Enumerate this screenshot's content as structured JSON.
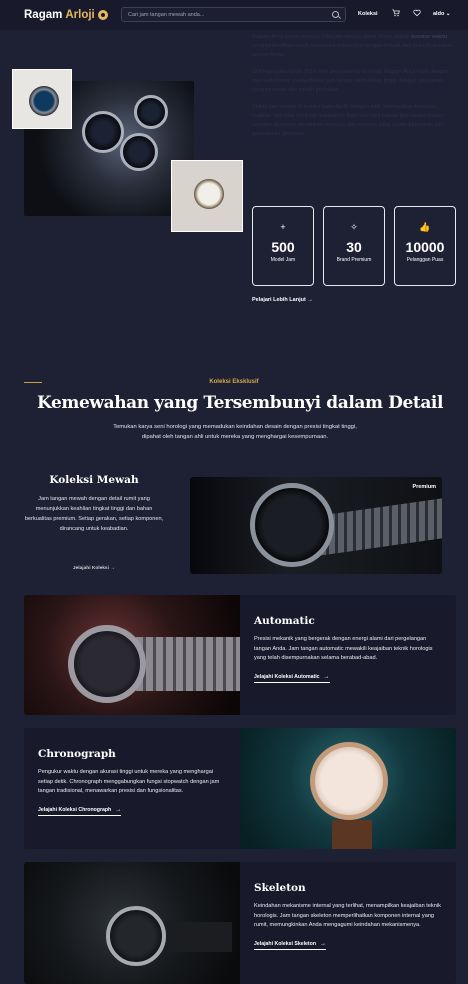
{
  "header": {
    "brand_main": "Ragam",
    "brand_accent": "Arloji",
    "search_placeholder": "Cari jam tangan mewah anda...",
    "nav_koleksi": "Koleksi",
    "user_name": "aldo",
    "cart_icon": "cart-icon",
    "heart_icon": "heart-icon"
  },
  "about": {
    "p1_a": "Ragam Arloji bukan sekadar toko jam tangan biasa. Kami adalah",
    "p1_b": "kurator waktu",
    "p1_c": "yang berdedikasi untuk membawa koleksi jam tangan terbaik dari seluruh dunia ke tangan Anda.",
    "p2": "Didirikan pada tahun 2010 oleh para pecinta horologi, Ragam Arloji telah dengan misi sederhana: menyediakan jam tangan berkualitas tinggi dengan pelayanan yang personal dan penuh perhatian.",
    "p3": "Setiap jam tangan di koleksi kami dipilih dengan teliti, memastikan keaslian, kualitas, dan nilai yang tak tertandingi. Kami percaya bahwa jam tangan bukan sekadar aksesoris melainkan investasi dan warisan yang dapat diturunkan dari generasi ke generasi.",
    "learn_more": "Pelajari Lebih Lanjut",
    "stats": [
      {
        "icon": "plus-icon",
        "glyph": "+",
        "value": "500",
        "label": "Model Jam"
      },
      {
        "icon": "sparkle-icon",
        "glyph": "✧",
        "value": "30",
        "label": "Brand Premium"
      },
      {
        "icon": "thumbs-up-icon",
        "glyph": "👍",
        "value": "10000",
        "label": "Pelanggan Puas"
      }
    ]
  },
  "exclusive": {
    "tag": "Koleksi Eksklusif",
    "title": "Kemewahan yang Tersembunyi dalam Detail",
    "desc": "Temukan karya seni horologi yang memadukan keindahan desain dengan presisi tingkat tinggi, dipahat oleh tangan ahli untuk mereka yang menghargai kesempurnaan."
  },
  "mewah": {
    "title": "Koleksi Mewah",
    "desc": "Jam tangan mewah dengan detail rumit yang menunjukkan keahlian tingkat tinggi dan bahan berkualitas premium. Setiap gerakan, setiap komponen, dirancang untuk keabadian.",
    "link": "Jelajahi Koleksi",
    "badge": "Premium"
  },
  "categories": [
    {
      "title": "Automatic",
      "desc": "Presisi mekanik yang bergerak dengan energi alami dari pergelangan tangan Anda. Jam tangan automatic mewakili keajaiban teknik horologis yang telah disempurnakan selama berabad-abad.",
      "link": "Jelajahi Koleksi Automatic"
    },
    {
      "title": "Chronograph",
      "desc": "Pengukur waktu dengan akurasi tinggi untuk mereka yang menghargai setiap detik. Chronograph menggabungkan fungsi stopwatch dengan jam tangan tradisional, menawarkan presisi dan fungsionalitas.",
      "link": "Jelajahi Koleksi Chronograph"
    },
    {
      "title": "Skeleton",
      "desc": "Keindahan mekanisme internal yang terlihat, menampilkan keajaiban teknik horologis. Jam tangan skeleton memperlihatkan komponen internal yang rumit, memungkinkan Anda mengagumi keindahan mekanismenya.",
      "link": "Jelajahi Koleksi Skeleton"
    }
  ],
  "arrow": "→"
}
